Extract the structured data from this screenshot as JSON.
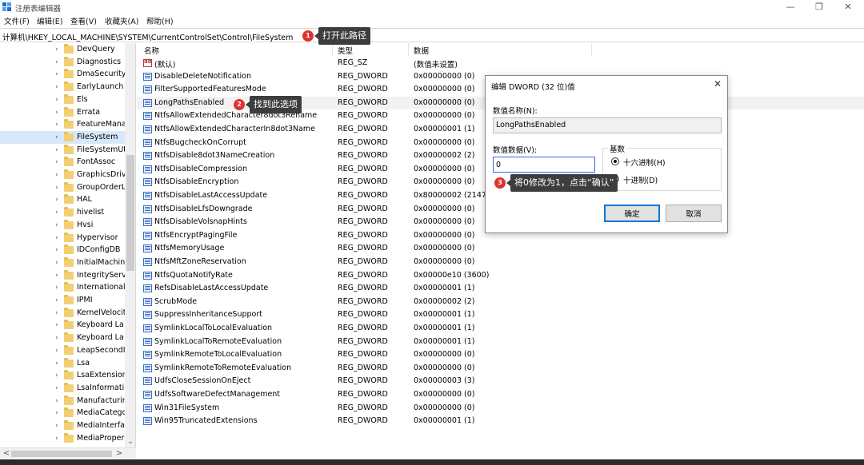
{
  "window": {
    "title": "注册表编辑器",
    "controls": {
      "minimize": "—",
      "maximize": "❐",
      "close": "✕"
    },
    "icon": "registry-icon"
  },
  "menu": [
    "文件(F)",
    "编辑(E)",
    "查看(V)",
    "收藏夹(A)",
    "帮助(H)"
  ],
  "address": "计算机\\HKEY_LOCAL_MACHINE\\SYSTEM\\CurrentControlSet\\Control\\FileSystem",
  "tree": {
    "items": [
      {
        "label": "DevQuery"
      },
      {
        "label": "Diagnostics"
      },
      {
        "label": "DmaSecurity"
      },
      {
        "label": "EarlyLaunch"
      },
      {
        "label": "Els"
      },
      {
        "label": "Errata"
      },
      {
        "label": "FeatureMana"
      },
      {
        "label": "FileSystem",
        "selected": true
      },
      {
        "label": "FileSystemUti"
      },
      {
        "label": "FontAssoc"
      },
      {
        "label": "GraphicsDriv"
      },
      {
        "label": "GroupOrderL"
      },
      {
        "label": "HAL"
      },
      {
        "label": "hivelist"
      },
      {
        "label": "Hvsi"
      },
      {
        "label": "Hypervisor"
      },
      {
        "label": "IDConfigDB"
      },
      {
        "label": "InitialMachin"
      },
      {
        "label": "IntegrityServi"
      },
      {
        "label": "International"
      },
      {
        "label": "IPMI"
      },
      {
        "label": "KernelVelocit"
      },
      {
        "label": "Keyboard La"
      },
      {
        "label": "Keyboard La"
      },
      {
        "label": "LeapSecondI"
      },
      {
        "label": "Lsa"
      },
      {
        "label": "LsaExtension"
      },
      {
        "label": "LsaInformati"
      },
      {
        "label": "Manufacturin"
      },
      {
        "label": "MediaCatego"
      },
      {
        "label": "MediaInterfa"
      },
      {
        "label": "MediaProper"
      }
    ]
  },
  "list": {
    "columns": {
      "name": "名称",
      "type": "类型",
      "data": "数据"
    },
    "rows": [
      {
        "name": "(默认)",
        "type": "REG_SZ",
        "data": "(数值未设置)",
        "kind": "string"
      },
      {
        "name": "DisableDeleteNotification",
        "type": "REG_DWORD",
        "data": "0x00000000 (0)"
      },
      {
        "name": "FilterSupportedFeaturesMode",
        "type": "REG_DWORD",
        "data": "0x00000000 (0)"
      },
      {
        "name": "LongPathsEnabled",
        "type": "REG_DWORD",
        "data": "0x00000000 (0)",
        "selected": true
      },
      {
        "name": "NtfsAllowExtendedCharacter8dot3Rename",
        "type": "REG_DWORD",
        "data": "0x00000000 (0)"
      },
      {
        "name": "NtfsAllowExtendedCharacterIn8dot3Name",
        "type": "REG_DWORD",
        "data": "0x00000001 (1)"
      },
      {
        "name": "NtfsBugcheckOnCorrupt",
        "type": "REG_DWORD",
        "data": "0x00000000 (0)"
      },
      {
        "name": "NtfsDisable8dot3NameCreation",
        "type": "REG_DWORD",
        "data": "0x00000002 (2)"
      },
      {
        "name": "NtfsDisableCompression",
        "type": "REG_DWORD",
        "data": "0x00000000 (0)"
      },
      {
        "name": "NtfsDisableEncryption",
        "type": "REG_DWORD",
        "data": "0x00000000 (0)"
      },
      {
        "name": "NtfsDisableLastAccessUpdate",
        "type": "REG_DWORD",
        "data": "0x80000002 (21474"
      },
      {
        "name": "NtfsDisableLfsDowngrade",
        "type": "REG_DWORD",
        "data": "0x00000000 (0)"
      },
      {
        "name": "NtfsDisableVolsnapHints",
        "type": "REG_DWORD",
        "data": "0x00000000 (0)"
      },
      {
        "name": "NtfsEncryptPagingFile",
        "type": "REG_DWORD",
        "data": "0x00000000 (0)"
      },
      {
        "name": "NtfsMemoryUsage",
        "type": "REG_DWORD",
        "data": "0x00000000 (0)"
      },
      {
        "name": "NtfsMftZoneReservation",
        "type": "REG_DWORD",
        "data": "0x00000000 (0)"
      },
      {
        "name": "NtfsQuotaNotifyRate",
        "type": "REG_DWORD",
        "data": "0x00000e10 (3600)"
      },
      {
        "name": "RefsDisableLastAccessUpdate",
        "type": "REG_DWORD",
        "data": "0x00000001 (1)"
      },
      {
        "name": "ScrubMode",
        "type": "REG_DWORD",
        "data": "0x00000002 (2)"
      },
      {
        "name": "SuppressInheritanceSupport",
        "type": "REG_DWORD",
        "data": "0x00000001 (1)"
      },
      {
        "name": "SymlinkLocalToLocalEvaluation",
        "type": "REG_DWORD",
        "data": "0x00000001 (1)"
      },
      {
        "name": "SymlinkLocalToRemoteEvaluation",
        "type": "REG_DWORD",
        "data": "0x00000001 (1)"
      },
      {
        "name": "SymlinkRemoteToLocalEvaluation",
        "type": "REG_DWORD",
        "data": "0x00000000 (0)"
      },
      {
        "name": "SymlinkRemoteToRemoteEvaluation",
        "type": "REG_DWORD",
        "data": "0x00000000 (0)"
      },
      {
        "name": "UdfsCloseSessionOnEject",
        "type": "REG_DWORD",
        "data": "0x00000003 (3)"
      },
      {
        "name": "UdfsSoftwareDefectManagement",
        "type": "REG_DWORD",
        "data": "0x00000000 (0)"
      },
      {
        "name": "Win31FileSystem",
        "type": "REG_DWORD",
        "data": "0x00000000 (0)"
      },
      {
        "name": "Win95TruncatedExtensions",
        "type": "REG_DWORD",
        "data": "0x00000001 (1)"
      }
    ]
  },
  "dialog": {
    "title": "编辑 DWORD (32 位)值",
    "close": "✕",
    "name_label": "数值名称(N):",
    "name_value": "LongPathsEnabled",
    "data_label": "数值数据(V):",
    "data_value": "0",
    "base_label": "基数",
    "hex_label": "十六进制(H)",
    "dec_label": "十进制(D)",
    "ok": "确定",
    "cancel": "取消"
  },
  "callouts": [
    {
      "number": "1",
      "text": "打开此路径"
    },
    {
      "number": "2",
      "text": "找到此选项"
    },
    {
      "number": "3",
      "text": "将0修改为1，点击“确认”"
    }
  ],
  "scroll": {
    "left": "<",
    "right": ">",
    "down": "⌄",
    "expand": "›"
  },
  "colors": {
    "selection": "#d6e8fa",
    "callout_badge": "#e0322e",
    "callout_box": "#3d3d3d",
    "folder": "#f2cf73",
    "focus": "#0078d7"
  }
}
